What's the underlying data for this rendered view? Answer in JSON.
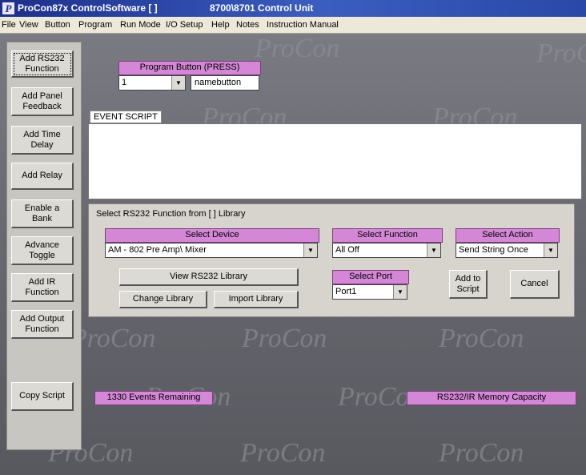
{
  "window": {
    "logo": "P",
    "title_left": "ProCon87x ControlSoftware [ ]",
    "title_right": "8700\\8701 Control Unit"
  },
  "menu": [
    "File",
    "View",
    "Button",
    "Program",
    "Run Mode",
    "I/O Setup",
    "Help",
    "Notes",
    "Instruction Manual"
  ],
  "sidebar": {
    "add_rs232": "Add RS232\nFunction",
    "add_panel_feedback": "Add Panel\nFeedback",
    "add_time_delay": "Add Time\nDelay",
    "add_relay": "Add Relay",
    "enable_bank": "Enable a\nBank",
    "advance_toggle": "Advance\nToggle",
    "add_ir": "Add IR\nFunction",
    "add_output": "Add Output\nFunction",
    "copy_script": "Copy Script"
  },
  "program_button": {
    "label": "Program Button (PRESS)",
    "selected": "1",
    "name": "namebutton"
  },
  "event_script": {
    "label": "EVENT SCRIPT"
  },
  "rs232_panel": {
    "title": "Select RS232 Function from [ ] Library",
    "device_label": "Select Device",
    "device_value": "AM - 802  Pre Amp\\ Mixer",
    "function_label": "Select Function",
    "function_value": "All Off",
    "action_label": "Select Action",
    "action_value": "Send String Once",
    "view_library": "View RS232 Library",
    "change_library": "Change Library",
    "import_library": "Import Library",
    "port_label": "Select Port",
    "port_value": "Port1",
    "add_to_script": "Add to\nScript",
    "cancel": "Cancel"
  },
  "status": {
    "events_remaining": "1330 Events Remaining",
    "memory_capacity": "RS232/IR Memory Capacity"
  },
  "watermark": "ProCon",
  "colors": {
    "label_pink": "#d487d6",
    "titlebar_blue": "#1d2f8c",
    "background_gray": "#6a6a72"
  }
}
